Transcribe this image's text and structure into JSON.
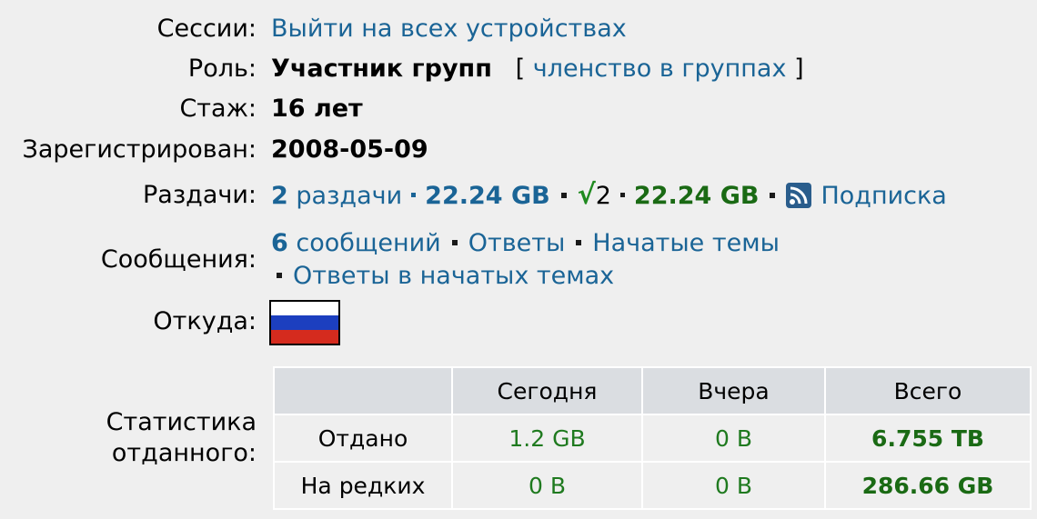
{
  "sessions": {
    "label": "Сессии:",
    "link": "Выйти на всех устройствах"
  },
  "role": {
    "label": "Роль:",
    "value": "Участник групп",
    "bracket_open": "[",
    "link": "членство в группах",
    "bracket_close": "]"
  },
  "tenure": {
    "label": "Стаж:",
    "value": "16 лет"
  },
  "registered": {
    "label": "Зарегистрирован:",
    "value": "2008-05-09"
  },
  "seeds": {
    "label": "Раздачи:",
    "count": "2",
    "count_text": "раздачи",
    "size": "22.24 GB",
    "check": "√",
    "active_count": "2",
    "active_size": "22.24 GB",
    "subscribe": "Подписка"
  },
  "messages": {
    "label": "Сообщения:",
    "count": "6",
    "count_text": "сообщений",
    "replies": "Ответы",
    "started": "Начатые темы",
    "replies_in_started": "Ответы в начатых темах"
  },
  "from": {
    "label": "Откуда:",
    "flag_colors": [
      "#ffffff",
      "#1c3fbf",
      "#d52b1e"
    ]
  },
  "stats": {
    "label_line1": "Статистика",
    "label_line2": "отданного:",
    "headers": [
      "",
      "Сегодня",
      "Вчера",
      "Всего"
    ],
    "rows": [
      {
        "name": "Отдано",
        "today": "1.2 GB",
        "yesterday": "0 B",
        "total": "6.755 TB"
      },
      {
        "name": "На редких",
        "today": "0 B",
        "yesterday": "0 B",
        "total": "286.66 GB"
      }
    ]
  },
  "colors": {
    "link": "#1a6496",
    "green": "#1f7a1f",
    "background": "#efefef"
  }
}
